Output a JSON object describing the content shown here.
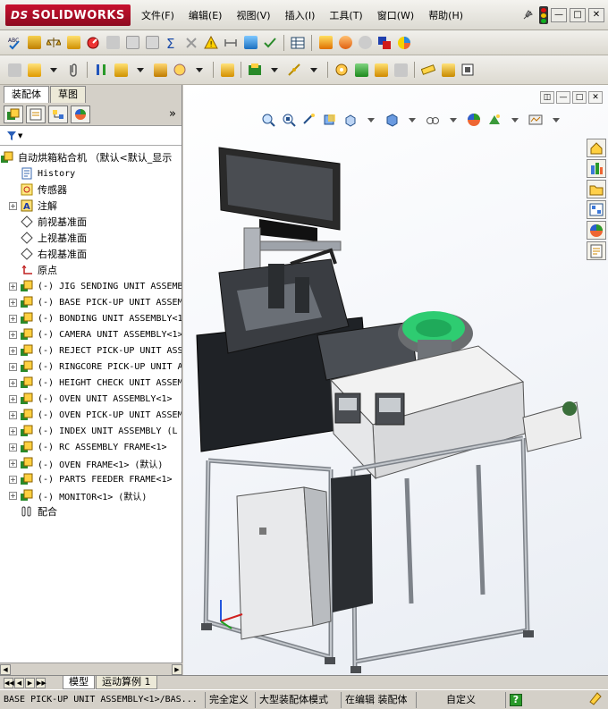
{
  "app": {
    "brand": "SOLIDWORKS",
    "brand_prefix": "DS"
  },
  "menus": [
    "文件(F)",
    "编辑(E)",
    "视图(V)",
    "插入(I)",
    "工具(T)",
    "窗口(W)",
    "帮助(H)"
  ],
  "window_controls": {
    "minimize": "—",
    "restore": "□",
    "close": "✕"
  },
  "panel": {
    "tabs": [
      "装配体",
      "草图"
    ],
    "more": "»",
    "filter_symbol": "▼"
  },
  "tree": {
    "root": "自动烘箱粘合机 （默认<默认_显示",
    "fixed": [
      "History",
      "传感器",
      "注解",
      "前视基准面",
      "上视基准面",
      "右视基准面",
      "原点"
    ],
    "components": [
      "(-) JIG SENDING UNIT ASSEMBLY",
      "(-) BASE PICK-UP UNIT ASSEMBLY",
      "(-) BONDING UNIT ASSEMBLY<1>",
      "(-) CAMERA UNIT ASSEMBLY<1>",
      "(-) REJECT PICK-UP UNIT ASSEMBLY",
      "(-) RINGCORE PICK-UP UNIT A",
      "(-) HEIGHT CHECK UNIT ASSEMBLY",
      "(-) OVEN UNIT ASSEMBLY<1>",
      "(-) OVEN PICK-UP UNIT ASSEMBLY",
      "(-) INDEX UNIT ASSEMBLY (L",
      "(-) RC ASSEMBLY  FRAME<1>",
      "(-) OVEN FRAME<1> (默认)",
      "(-) PARTS FEEDER FRAME<1>",
      "(-) MONITOR<1> (默认)"
    ],
    "mates": "配合"
  },
  "bottom_tabs": [
    "模型",
    "运动算例 1"
  ],
  "status": {
    "selection": "BASE PICK-UP UNIT ASSEMBLY<1>/BAS...",
    "defined": "完全定义",
    "mode": "大型装配体模式",
    "editing": "在编辑 装配体",
    "custom": "自定义",
    "help": "?"
  },
  "colors": {
    "accent_red": "#c8102e",
    "feeder_green": "#2ecc71",
    "frame_grey": "#b8bcc2"
  }
}
